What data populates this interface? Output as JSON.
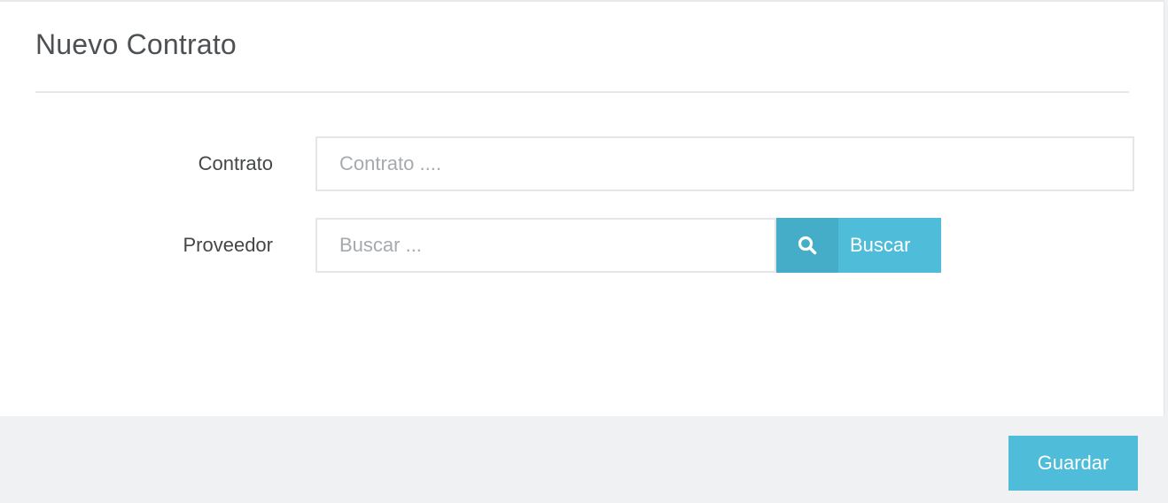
{
  "form": {
    "title": "Nuevo Contrato",
    "contrato": {
      "label": "Contrato",
      "placeholder": "Contrato ....",
      "value": ""
    },
    "proveedor": {
      "label": "Proveedor",
      "placeholder": "Buscar ...",
      "value": "",
      "search_button_label": "Buscar",
      "search_icon": "search-icon"
    }
  },
  "footer": {
    "save_label": "Guardar"
  },
  "colors": {
    "accent": "#4fbcd9",
    "accent_dark": "#45adc8",
    "footer_bg": "#eff1f3"
  }
}
